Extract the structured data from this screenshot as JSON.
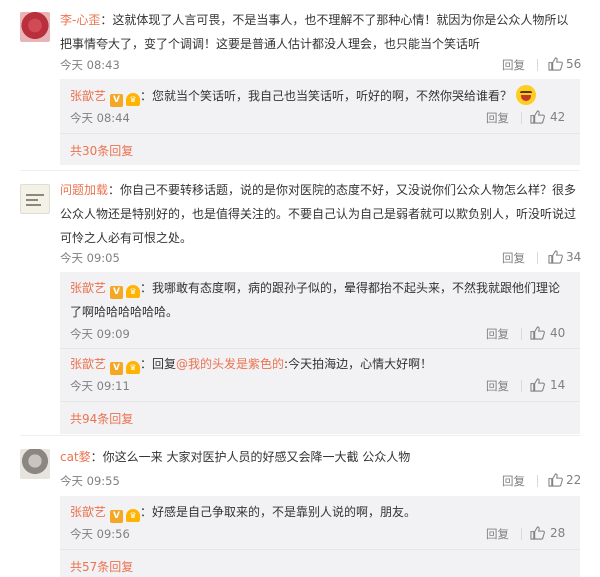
{
  "actions": {
    "reply": "回复"
  },
  "colors": {
    "link": "#eb7350",
    "meta": "#808080",
    "subbg": "#f2f2f5"
  },
  "comments": [
    {
      "user": "李-心歪",
      "text": "：这就体现了人言可畏，不是当事人，也不理解不了那种心情！就因为你是公众人物所以把事情夸大了，变了个调调！这要是普通人估计都没人理会，也只能当个笑话听",
      "time": "今天 08:43",
      "likes": "56",
      "replies": [
        {
          "user": "张歆艺",
          "text": "：您就当个笑话听，我自己也当笑话听，听好的啊，不然你哭给谁看？",
          "time": "今天 08:44",
          "likes": "42"
        }
      ],
      "more": "共30条回复"
    },
    {
      "user": "问题加载",
      "text": "：你自己不要转移话题，说的是你对医院的态度不好，又没说你们公众人物怎么样？很多公众人物还是特别好的，也是值得关注的。不要自己认为自己是弱者就可以欺负别人，听没听说过可怜之人必有可恨之处。",
      "time": "今天 09:05",
      "likes": "34",
      "replies": [
        {
          "user": "张歆艺",
          "text": "：我哪敢有态度啊，病的跟孙子似的，晕得都抬不起头来，不然我就跟他们理论了啊哈哈哈哈哈哈。",
          "time": "今天 09:09",
          "likes": "40"
        },
        {
          "user": "张歆艺",
          "text_prefix": "：回复",
          "mention": "@我的头发是紫色的",
          "text": ":今天拍海边，心情大好啊！",
          "time": "今天 09:11",
          "likes": "14"
        }
      ],
      "more": "共94条回复"
    },
    {
      "user": "cat婺",
      "text": "：你这么一来  大家对医护人员的好感又会降一大截   公众人物",
      "time": "今天 09:55",
      "likes": "22",
      "replies": [
        {
          "user": "张歆艺",
          "text": "：好感是自己争取来的，不是靠别人说的啊，朋友。",
          "time": "今天 09:56",
          "likes": "28"
        }
      ],
      "more": "共57条回复"
    }
  ]
}
